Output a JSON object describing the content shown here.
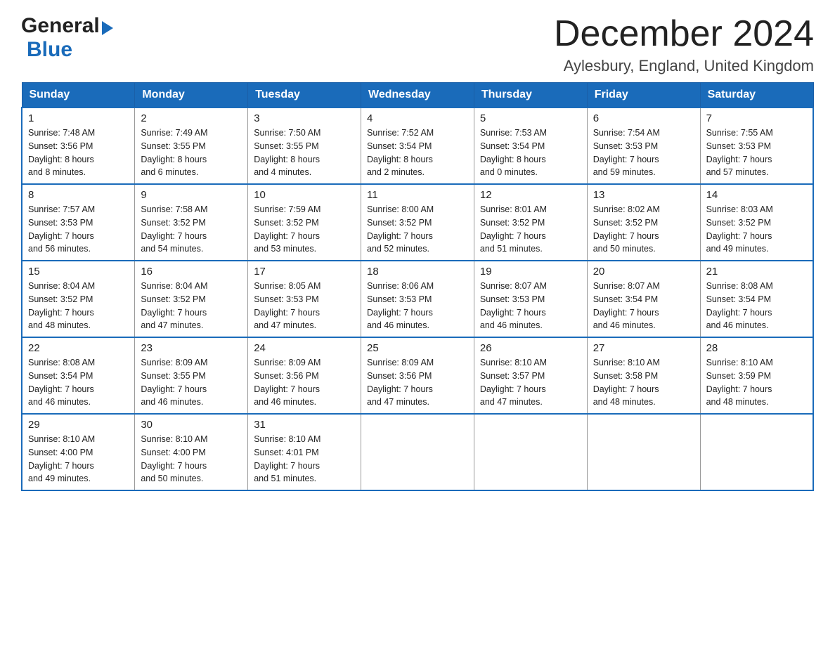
{
  "header": {
    "logo_general": "General",
    "logo_blue": "Blue",
    "title": "December 2024",
    "subtitle": "Aylesbury, England, United Kingdom"
  },
  "weekdays": [
    "Sunday",
    "Monday",
    "Tuesday",
    "Wednesday",
    "Thursday",
    "Friday",
    "Saturday"
  ],
  "weeks": [
    [
      {
        "day": "1",
        "info": "Sunrise: 7:48 AM\nSunset: 3:56 PM\nDaylight: 8 hours\nand 8 minutes."
      },
      {
        "day": "2",
        "info": "Sunrise: 7:49 AM\nSunset: 3:55 PM\nDaylight: 8 hours\nand 6 minutes."
      },
      {
        "day": "3",
        "info": "Sunrise: 7:50 AM\nSunset: 3:55 PM\nDaylight: 8 hours\nand 4 minutes."
      },
      {
        "day": "4",
        "info": "Sunrise: 7:52 AM\nSunset: 3:54 PM\nDaylight: 8 hours\nand 2 minutes."
      },
      {
        "day": "5",
        "info": "Sunrise: 7:53 AM\nSunset: 3:54 PM\nDaylight: 8 hours\nand 0 minutes."
      },
      {
        "day": "6",
        "info": "Sunrise: 7:54 AM\nSunset: 3:53 PM\nDaylight: 7 hours\nand 59 minutes."
      },
      {
        "day": "7",
        "info": "Sunrise: 7:55 AM\nSunset: 3:53 PM\nDaylight: 7 hours\nand 57 minutes."
      }
    ],
    [
      {
        "day": "8",
        "info": "Sunrise: 7:57 AM\nSunset: 3:53 PM\nDaylight: 7 hours\nand 56 minutes."
      },
      {
        "day": "9",
        "info": "Sunrise: 7:58 AM\nSunset: 3:52 PM\nDaylight: 7 hours\nand 54 minutes."
      },
      {
        "day": "10",
        "info": "Sunrise: 7:59 AM\nSunset: 3:52 PM\nDaylight: 7 hours\nand 53 minutes."
      },
      {
        "day": "11",
        "info": "Sunrise: 8:00 AM\nSunset: 3:52 PM\nDaylight: 7 hours\nand 52 minutes."
      },
      {
        "day": "12",
        "info": "Sunrise: 8:01 AM\nSunset: 3:52 PM\nDaylight: 7 hours\nand 51 minutes."
      },
      {
        "day": "13",
        "info": "Sunrise: 8:02 AM\nSunset: 3:52 PM\nDaylight: 7 hours\nand 50 minutes."
      },
      {
        "day": "14",
        "info": "Sunrise: 8:03 AM\nSunset: 3:52 PM\nDaylight: 7 hours\nand 49 minutes."
      }
    ],
    [
      {
        "day": "15",
        "info": "Sunrise: 8:04 AM\nSunset: 3:52 PM\nDaylight: 7 hours\nand 48 minutes."
      },
      {
        "day": "16",
        "info": "Sunrise: 8:04 AM\nSunset: 3:52 PM\nDaylight: 7 hours\nand 47 minutes."
      },
      {
        "day": "17",
        "info": "Sunrise: 8:05 AM\nSunset: 3:53 PM\nDaylight: 7 hours\nand 47 minutes."
      },
      {
        "day": "18",
        "info": "Sunrise: 8:06 AM\nSunset: 3:53 PM\nDaylight: 7 hours\nand 46 minutes."
      },
      {
        "day": "19",
        "info": "Sunrise: 8:07 AM\nSunset: 3:53 PM\nDaylight: 7 hours\nand 46 minutes."
      },
      {
        "day": "20",
        "info": "Sunrise: 8:07 AM\nSunset: 3:54 PM\nDaylight: 7 hours\nand 46 minutes."
      },
      {
        "day": "21",
        "info": "Sunrise: 8:08 AM\nSunset: 3:54 PM\nDaylight: 7 hours\nand 46 minutes."
      }
    ],
    [
      {
        "day": "22",
        "info": "Sunrise: 8:08 AM\nSunset: 3:54 PM\nDaylight: 7 hours\nand 46 minutes."
      },
      {
        "day": "23",
        "info": "Sunrise: 8:09 AM\nSunset: 3:55 PM\nDaylight: 7 hours\nand 46 minutes."
      },
      {
        "day": "24",
        "info": "Sunrise: 8:09 AM\nSunset: 3:56 PM\nDaylight: 7 hours\nand 46 minutes."
      },
      {
        "day": "25",
        "info": "Sunrise: 8:09 AM\nSunset: 3:56 PM\nDaylight: 7 hours\nand 47 minutes."
      },
      {
        "day": "26",
        "info": "Sunrise: 8:10 AM\nSunset: 3:57 PM\nDaylight: 7 hours\nand 47 minutes."
      },
      {
        "day": "27",
        "info": "Sunrise: 8:10 AM\nSunset: 3:58 PM\nDaylight: 7 hours\nand 48 minutes."
      },
      {
        "day": "28",
        "info": "Sunrise: 8:10 AM\nSunset: 3:59 PM\nDaylight: 7 hours\nand 48 minutes."
      }
    ],
    [
      {
        "day": "29",
        "info": "Sunrise: 8:10 AM\nSunset: 4:00 PM\nDaylight: 7 hours\nand 49 minutes."
      },
      {
        "day": "30",
        "info": "Sunrise: 8:10 AM\nSunset: 4:00 PM\nDaylight: 7 hours\nand 50 minutes."
      },
      {
        "day": "31",
        "info": "Sunrise: 8:10 AM\nSunset: 4:01 PM\nDaylight: 7 hours\nand 51 minutes."
      },
      {
        "day": "",
        "info": ""
      },
      {
        "day": "",
        "info": ""
      },
      {
        "day": "",
        "info": ""
      },
      {
        "day": "",
        "info": ""
      }
    ]
  ]
}
